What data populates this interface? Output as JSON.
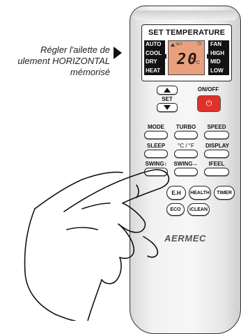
{
  "caption": {
    "lines": [
      "Régler l'ailette de",
      "ulement HORIZONTAL",
      "mémorisé"
    ]
  },
  "display": {
    "title": "SET  TEMPERATURE",
    "modes_left": [
      "AUTO",
      "COOL",
      "DRY",
      "HEAT"
    ],
    "modes_right": [
      "FAN",
      "HIGH",
      "MID",
      "LOW"
    ],
    "lcd_small": "SET",
    "lcd_power": "⏻",
    "temperature": "20",
    "unit": "°C"
  },
  "buttons": {
    "set": "SET",
    "onoff": "ON/OFF",
    "onoff_icon": "⏻",
    "mode": "MODE",
    "turbo": "TURBO",
    "speed": "SPEED",
    "sleep": "SLEEP",
    "cf": "°C / °F",
    "display": "DISPLAY",
    "swing_v": "SWING↕",
    "swing_h": "SWING↔",
    "ifeel": "IFEEL",
    "eh": "E.H",
    "health": "HEALTH",
    "timer": "TIMER",
    "eco": "ECO",
    "iclean": "iCLEAN"
  },
  "brand": "AERMEC",
  "colors": {
    "onoff": "#e0302b",
    "lcd": "#e8a07e"
  }
}
